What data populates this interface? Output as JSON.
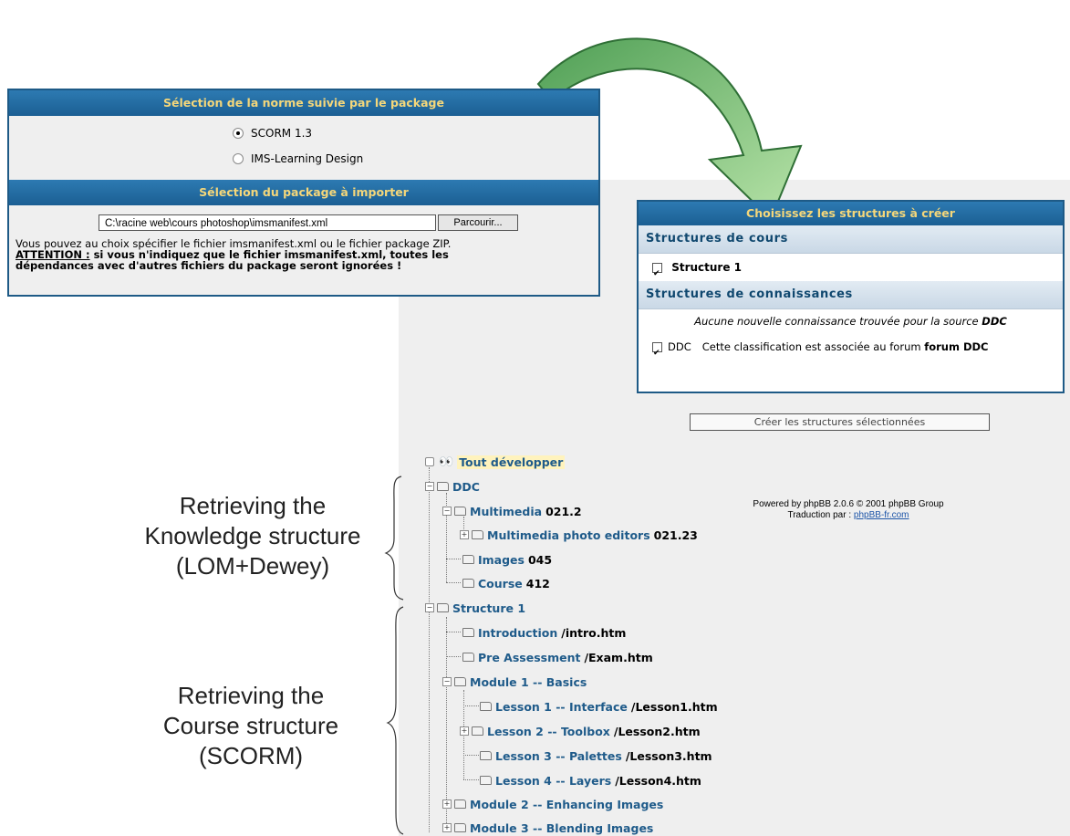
{
  "import_panel": {
    "norm_header": "Sélection de la norme suivie par le package",
    "options": [
      {
        "label": "SCORM 1.3",
        "selected": true
      },
      {
        "label": "IMS-Learning Design",
        "selected": false
      }
    ],
    "package_header": "Sélection du package à importer",
    "file_value": "C:\\racine web\\cours photoshop\\imsmanifest.xml",
    "browse_label": "Parcourir...",
    "notice_line1": "Vous pouvez au choix spécifier le fichier imsmanifest.xml ou le fichier package ZIP.",
    "attention_label": "ATTENTION :",
    "attention_text": " si vous n'indiquez que le fichier imsmanifest.xml, toutes les",
    "attention_text2": "dépendances avec d'autres fichiers du package seront ignorées !"
  },
  "struct_panel": {
    "header": "Choisissez les structures à créer",
    "course_header": "Structures de cours",
    "course_item": "Structure 1",
    "course_item_checked": true,
    "knowledge_header": "Structures de connaissances",
    "no_knowledge_text": "Aucune nouvelle connaissance trouvée pour la source ",
    "no_knowledge_source": "DDC",
    "ddc_label": "DDC",
    "ddc_checked": true,
    "ddc_text": "Cette classification est associée au forum ",
    "ddc_forum": "forum DDC"
  },
  "create_button": "Créer les structures sélectionnées",
  "powered": {
    "line1": "Powered by phpBB 2.0.6 © 2001 phpBB Group",
    "line2_prefix": "Traduction par : ",
    "line2_link": "phpBB-fr.com"
  },
  "tree": {
    "expand_all": "Tout développer",
    "nodes": [
      {
        "label": "DDC",
        "path": ""
      },
      {
        "label": "Multimedia",
        "path": "021.2"
      },
      {
        "label": "Multimedia photo editors",
        "path": "021.23"
      },
      {
        "label": "Images",
        "path": "045"
      },
      {
        "label": "Course",
        "path": "412"
      },
      {
        "label": "Structure 1",
        "path": ""
      },
      {
        "label": "Introduction",
        "path": "/intro.htm"
      },
      {
        "label": "Pre Assessment",
        "path": "/Exam.htm"
      },
      {
        "label": "Module 1 -- Basics",
        "path": ""
      },
      {
        "label": "Lesson 1 -- Interface",
        "path": "/Lesson1.htm"
      },
      {
        "label": "Lesson 2 -- Toolbox",
        "path": "/Lesson2.htm"
      },
      {
        "label": "Lesson 3 -- Palettes",
        "path": "/Lesson3.htm"
      },
      {
        "label": "Lesson 4 -- Layers",
        "path": "/Lesson4.htm"
      },
      {
        "label": "Module 2 -- Enhancing Images",
        "path": ""
      },
      {
        "label": "Module 3 -- Blending Images",
        "path": ""
      }
    ]
  },
  "annotations": {
    "knowledge": [
      "Retrieving the",
      "Knowledge structure",
      "(LOM+Dewey)"
    ],
    "course": [
      "Retrieving the",
      "Course structure",
      "(SCORM)"
    ]
  },
  "colors": {
    "header_bar": "#1b5f93",
    "header_text": "#f5d77a",
    "arrow": "#8fcf80",
    "link": "#1f5b8a"
  }
}
